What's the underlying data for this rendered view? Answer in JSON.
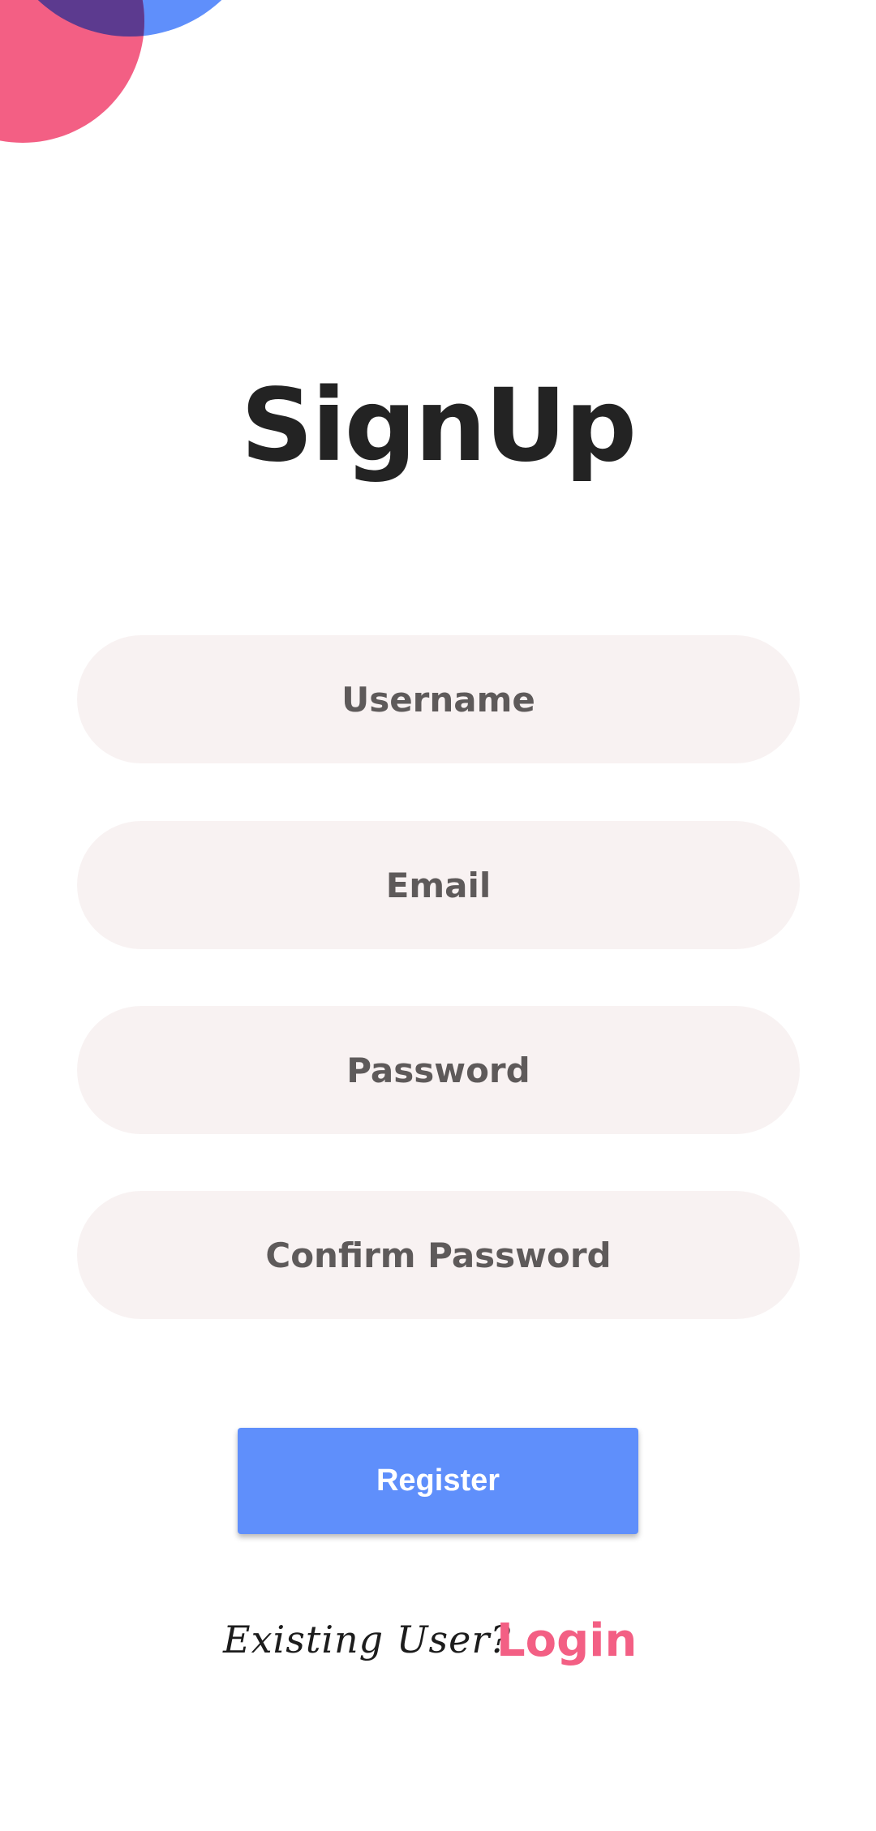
{
  "screen": {
    "title": "SignUp"
  },
  "form": {
    "username_placeholder": "Username",
    "email_placeholder": "Email",
    "password_placeholder": "Password",
    "confirm_password_placeholder": "Confirm Password",
    "register_label": "Register"
  },
  "footer": {
    "existing_user_text": "Existing User?",
    "login_label": "Login"
  },
  "colors": {
    "accent_blue": "#5f8ffb",
    "accent_pink": "#f35f84",
    "field_bg": "#f8f2f2",
    "title": "#232323"
  }
}
